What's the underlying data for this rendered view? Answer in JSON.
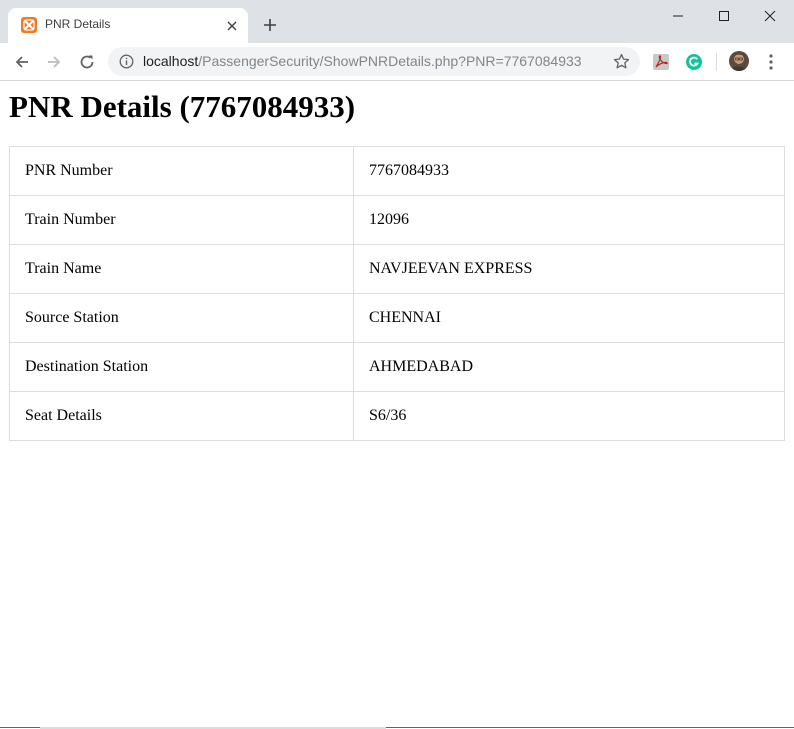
{
  "browser": {
    "tab_title": "PNR Details",
    "url_host": "localhost",
    "url_path": "/PassengerSecurity/ShowPNRDetails.php?PNR=7767084933"
  },
  "page": {
    "heading": "PNR Details (7767084933)",
    "rows": [
      {
        "label": "PNR Number",
        "value": "7767084933"
      },
      {
        "label": "Train Number",
        "value": "12096"
      },
      {
        "label": "Train Name",
        "value": "NAVJEEVAN EXPRESS"
      },
      {
        "label": "Source Station",
        "value": "CHENNAI"
      },
      {
        "label": "Destination Station",
        "value": "AHMEDABAD"
      },
      {
        "label": "Seat Details",
        "value": "S6/36"
      }
    ]
  },
  "colors": {
    "favicon": "#f07b24",
    "grammarly": "#15c39a",
    "window_border": "#2a6fb5"
  },
  "icons": {
    "favicon": "xampp-icon",
    "tab_close": "close-icon",
    "new_tab": "plus-icon",
    "back": "arrow-left-icon",
    "forward": "arrow-right-icon",
    "reload": "reload-icon",
    "site_info": "info-icon",
    "bookmark": "star-icon",
    "pdf_extension": "acrobat-icon",
    "grammarly_extension": "grammarly-icon",
    "menu": "kebab-menu-icon"
  }
}
